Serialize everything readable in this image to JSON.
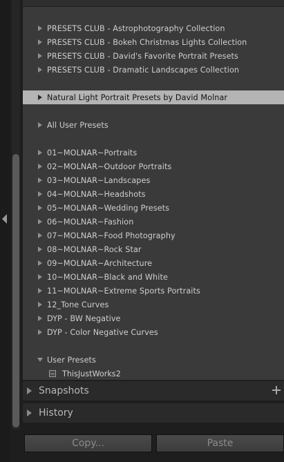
{
  "presets": {
    "club": [
      "PRESETS CLUB - Astrophotography Collection",
      "PRESETS CLUB - Bokeh Christmas Lights Collection",
      "PRESETS CLUB - David's Favorite Portrait Presets",
      "PRESETS CLUB - Dramatic Landscapes Collection"
    ],
    "selected": "Natural Light Portrait Presets by David Molnar",
    "all_user": "All User Presets",
    "molnar": [
      "01~MOLNAR~Portraits",
      "02~MOLNAR~Outdoor Portraits",
      "03~MOLNAR~Landscapes",
      "04~MOLNAR~Headshots",
      "05~MOLNAR~Wedding Presets",
      "06~MOLNAR~Fashion",
      "07~MOLNAR~Food Photography",
      "08~MOLNAR~Rock Star",
      "09~MOLNAR~Architecture",
      "10~MOLNAR~Black and White",
      "11~MOLNAR~Extreme Sports Portraits",
      "12_Tone Curves",
      "DYP - BW Negative",
      "DYP - Color Negative Curves"
    ],
    "user_presets": {
      "label": "User Presets",
      "items": [
        "ThisJustWorks2"
      ]
    }
  },
  "sections": {
    "snapshots": "Snapshots",
    "history": "History"
  },
  "buttons": {
    "copy": "Copy...",
    "paste": "Paste"
  },
  "icons": {
    "collapse": "chevron-left-icon",
    "expand": "triangle-right-icon",
    "add": "plus-icon",
    "preset": "preset-icon"
  }
}
